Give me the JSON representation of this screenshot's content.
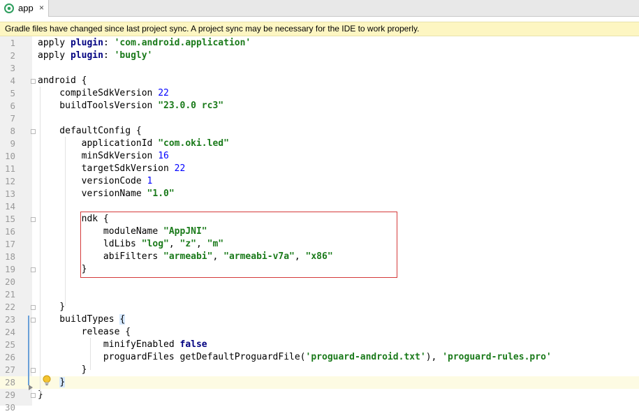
{
  "tab": {
    "label": "app",
    "close": "×",
    "icon": "gradle-module-icon"
  },
  "banner": {
    "text": "Gradle files have changed since last project sync. A project sync may be necessary for the IDE to work properly."
  },
  "editor": {
    "line_numbers": [
      "1",
      "2",
      "3",
      "4",
      "5",
      "6",
      "7",
      "8",
      "9",
      "10",
      "11",
      "12",
      "13",
      "14",
      "15",
      "16",
      "17",
      "18",
      "19",
      "20",
      "21",
      "22",
      "23",
      "24",
      "25",
      "26",
      "27",
      "28",
      "29",
      "30"
    ],
    "lines": [
      {
        "pre": "apply ",
        "kw": "plugin",
        "mid": ": ",
        "str": "'com.android.application'"
      },
      {
        "pre": "apply ",
        "kw": "plugin",
        "mid": ": ",
        "str": "'bugly'"
      },
      {
        "pre": ""
      },
      {
        "pre": "android {"
      },
      {
        "pre": "    compileSdkVersion ",
        "num": "22"
      },
      {
        "pre": "    buildToolsVersion ",
        "str": "\"23.0.0 rc3\""
      },
      {
        "pre": ""
      },
      {
        "pre": "    defaultConfig {"
      },
      {
        "pre": "        applicationId ",
        "str": "\"com.oki.led\""
      },
      {
        "pre": "        minSdkVersion ",
        "num": "16"
      },
      {
        "pre": "        targetSdkVersion ",
        "num": "22"
      },
      {
        "pre": "        versionCode ",
        "num": "1"
      },
      {
        "pre": "        versionName ",
        "str": "\"1.0\""
      },
      {
        "pre": ""
      },
      {
        "pre": "        ndk {"
      },
      {
        "pre": "            moduleName ",
        "str": "\"AppJNI\""
      },
      {
        "pre": "            ldLibs ",
        "str": "\"log\"",
        "post1": ", ",
        "str2": "\"z\"",
        "post2": ", ",
        "str3": "\"m\""
      },
      {
        "pre": "            abiFilters ",
        "str": "\"armeabi\"",
        "post1": ", ",
        "str2": "\"armeabi-v7a\"",
        "post2": ", ",
        "str3": "\"x86\""
      },
      {
        "pre": "        }"
      },
      {
        "pre": ""
      },
      {
        "pre": ""
      },
      {
        "pre": "    }"
      },
      {
        "pre": "    buildTypes ",
        "brace": "{"
      },
      {
        "pre": "        release {"
      },
      {
        "pre": "            minifyEnabled ",
        "kw": "false"
      },
      {
        "pre": "            proguardFiles getDefaultProguardFile(",
        "str": "'proguard-android.txt'",
        "post1": "), ",
        "str2": "'proguard-rules.pro'"
      },
      {
        "pre": "        }"
      },
      {
        "pre": "    ",
        "brace": "}"
      },
      {
        "pre": "}"
      },
      {
        "pre": ""
      }
    ],
    "current_line": 28,
    "colors": {
      "string": "#1a7a1a",
      "number": "#0000ff",
      "keyword": "#000080",
      "highlight_box": "#d43a3a",
      "banner": "#fdf6c2"
    }
  }
}
